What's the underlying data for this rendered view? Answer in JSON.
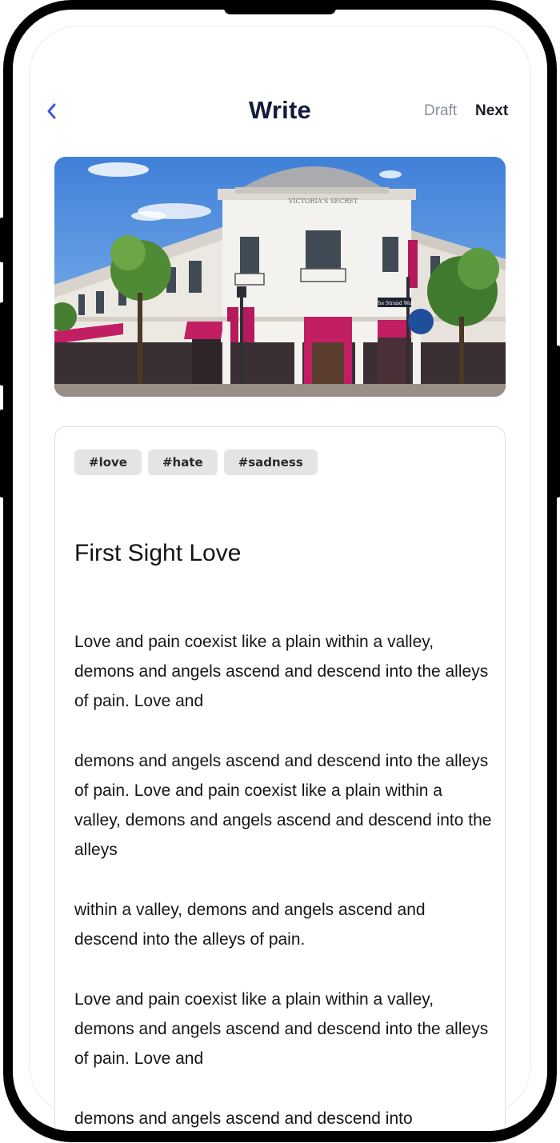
{
  "header": {
    "title": "Write",
    "draft_label": "Draft",
    "next_label": "Next"
  },
  "photo": {
    "storefront_sign": "VICTORIA'S SECRET",
    "street_sign": "The Strand Way"
  },
  "tags": [
    "#love",
    "#hate",
    "#sadness"
  ],
  "post": {
    "title": "First Sight Love",
    "paragraphs": [
      "Love and pain coexist like a plain within a valley, demons and angels ascend and descend into the alleys of pain. Love and",
      "demons and angels ascend and descend into the alleys of pain. Love and pain coexist like a plain within a valley, demons and angels ascend and descend into the alleys",
      "within a valley, demons and angels ascend and descend into the alleys of pain.",
      "Love and pain coexist like a plain within a valley, demons and angels ascend and descend into the alleys of pain. Love and",
      "demons and angels ascend and descend into"
    ]
  },
  "colors": {
    "back_accent": "#3d5bd6",
    "title": "#141b3d",
    "draft": "#8a8f9c",
    "awning": "#c21e63",
    "sky": "#5a95e0"
  },
  "icons": {
    "back": "chevron-left-icon"
  }
}
